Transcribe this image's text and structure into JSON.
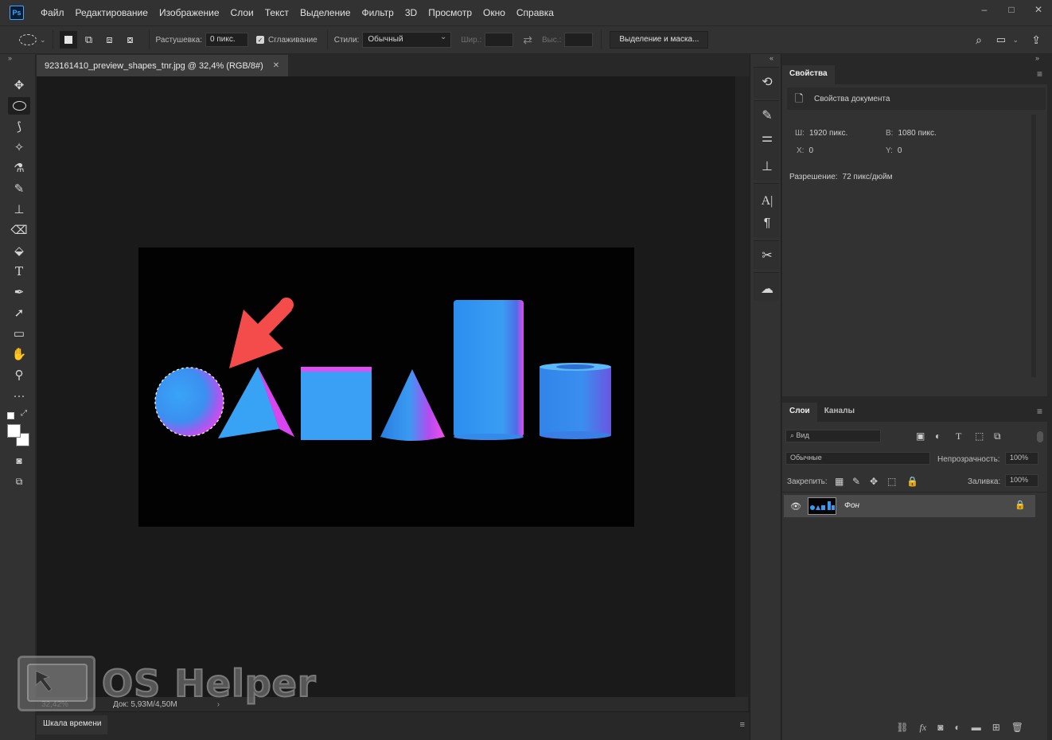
{
  "app": {
    "logo": "Ps"
  },
  "menu": [
    "Файл",
    "Редактирование",
    "Изображение",
    "Слои",
    "Текст",
    "Выделение",
    "Фильтр",
    "3D",
    "Просмотр",
    "Окно",
    "Справка"
  ],
  "window_controls": [
    "–",
    "□",
    "✕"
  ],
  "options": {
    "feather_label": "Растушевка:",
    "feather_value": "0 пикс.",
    "antialias_label": "Сглаживание",
    "styles_label": "Стили:",
    "styles_value": "Обычный",
    "width_label": "Шир.:",
    "height_label": "Выс.:",
    "mask_button": "Выделение и маска..."
  },
  "document": {
    "tab_title": "923161410_preview_shapes_tnr.jpg @ 32,4% (RGB/8#)",
    "zoom": "32,42%",
    "doc_info": "Док: 5,93M/4,50M"
  },
  "timeline": {
    "label": "Шкала времени"
  },
  "properties": {
    "tab": "Свойства",
    "section_title": "Свойства документа",
    "w_label": "Ш:",
    "w_value": "1920 пикс.",
    "h_label": "В:",
    "h_value": "1080 пикс.",
    "x_label": "X:",
    "x_value": "0",
    "y_label": "Y:",
    "y_value": "0",
    "resolution_label": "Разрешение:",
    "resolution_value": "72 пикс/дюйм"
  },
  "layers": {
    "tabs": [
      "Слои",
      "Каналы"
    ],
    "filter_placeholder": "Вид",
    "blend_mode": "Обычные",
    "opacity_label": "Непрозрачность:",
    "opacity_value": "100%",
    "lock_label": "Закрепить:",
    "fill_label": "Заливка:",
    "fill_value": "100%",
    "items": [
      {
        "name": "Фон"
      }
    ]
  },
  "watermark": {
    "text": "OS Helper"
  }
}
